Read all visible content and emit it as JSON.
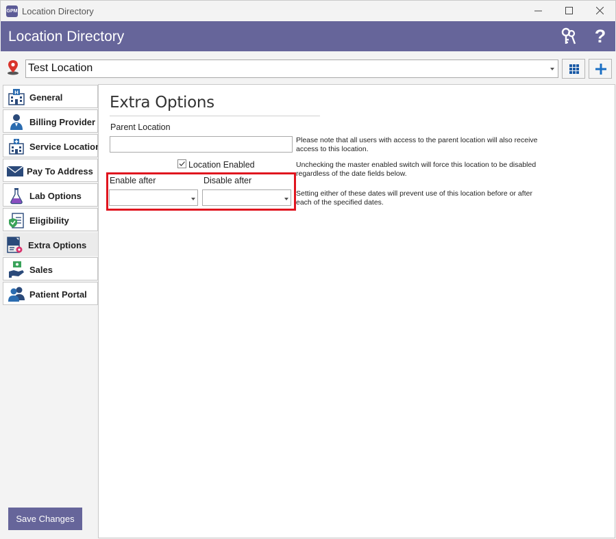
{
  "window": {
    "title": "Location Directory",
    "icon": "app-icon",
    "icon_text": "GPM",
    "controls": [
      "minimize",
      "maximize",
      "close"
    ]
  },
  "header": {
    "title": "Location Directory",
    "keys_icon": "keys-icon",
    "help_icon": "help-icon",
    "color": "#66659a"
  },
  "location_bar": {
    "selected": "Test Location",
    "grid_button_icon": "grid-icon",
    "add_button_icon": "plus-icon"
  },
  "sidebar": {
    "items": [
      {
        "label": "General",
        "icon": "hospital-icon"
      },
      {
        "label": "Billing Provider",
        "icon": "doctor-icon"
      },
      {
        "label": "Service Location",
        "icon": "building-icon"
      },
      {
        "label": "Pay To Address",
        "icon": "envelope-icon"
      },
      {
        "label": "Lab Options",
        "icon": "flask-icon"
      },
      {
        "label": "Eligibility",
        "icon": "checklist-icon"
      },
      {
        "label": "Extra Options",
        "icon": "settings-doc-icon",
        "active": true
      },
      {
        "label": "Sales",
        "icon": "money-hand-icon"
      },
      {
        "label": "Patient Portal",
        "icon": "users-icon"
      }
    ],
    "save_label": "Save Changes"
  },
  "extra_options": {
    "title": "Extra Options",
    "parent_location_label": "Parent Location",
    "parent_location_value": "",
    "parent_note": "Please note that all users with access to the parent location will also receive access to this location.",
    "location_enabled_label": "Location Enabled",
    "location_enabled_checked": true,
    "enabled_note": "Unchecking the master enabled switch will force this location to be disabled regardless of the date fields below.",
    "enable_after_label": "Enable after",
    "disable_after_label": "Disable after",
    "enable_after_value": "",
    "disable_after_value": "",
    "dates_note": "Setting either of these dates will prevent use of this location before or after each of the specified dates.",
    "highlight_color": "#e0141e"
  }
}
